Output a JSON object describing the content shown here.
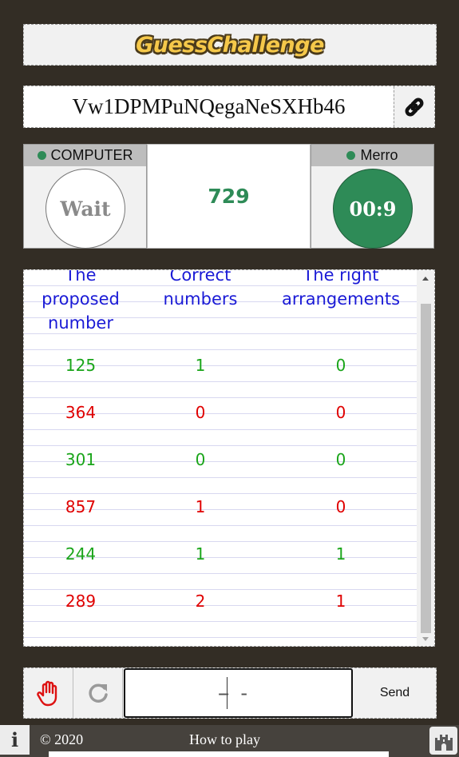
{
  "header": {
    "title": "GuessChallenge"
  },
  "room": {
    "code": "Vw1DPMPuNQegaNeSXHb46",
    "link_icon": "link-icon"
  },
  "players": {
    "left": {
      "name": "COMPUTER",
      "status_color": "#2e8b57",
      "state": "Wait"
    },
    "right": {
      "name": "Merro",
      "status_color": "#2e8b57",
      "timer": "00:9"
    }
  },
  "center": {
    "number": "729"
  },
  "table": {
    "headers": [
      "The proposed number",
      "Correct numbers",
      "The right arrangements"
    ],
    "rows": [
      {
        "number": "125",
        "correct": "1",
        "arranged": "0",
        "color": "green"
      },
      {
        "number": "364",
        "correct": "0",
        "arranged": "0",
        "color": "red"
      },
      {
        "number": "301",
        "correct": "0",
        "arranged": "0",
        "color": "green"
      },
      {
        "number": "857",
        "correct": "1",
        "arranged": "0",
        "color": "red"
      },
      {
        "number": "244",
        "correct": "1",
        "arranged": "1",
        "color": "green"
      },
      {
        "number": "289",
        "correct": "2",
        "arranged": "1",
        "color": "red"
      }
    ]
  },
  "input": {
    "digits": [
      "-",
      "-",
      "-"
    ],
    "send_label": "Send",
    "hand_icon": "hand-icon",
    "retry_icon": "retry-icon"
  },
  "footer": {
    "info_label": "i",
    "copyright": "© 2020",
    "how_to_play": "How to play",
    "castle_icon": "castle-icon"
  },
  "colors": {
    "accent": "#2e8b57",
    "green_text": "#1aa51a",
    "red_text": "#e00000",
    "header_text": "#1a1ad6"
  }
}
